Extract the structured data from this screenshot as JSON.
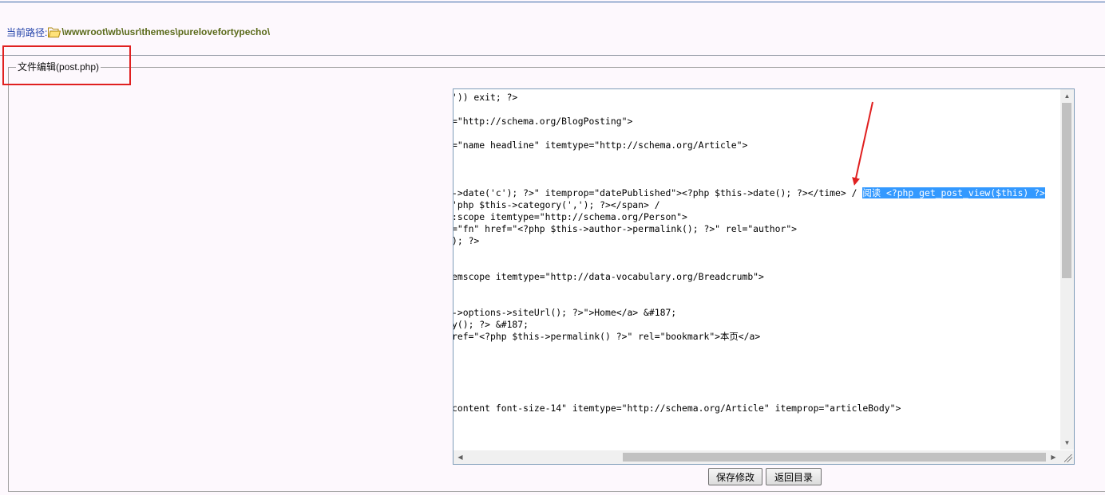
{
  "path": {
    "label": "当前路径:",
    "icon": "folder-icon",
    "value": "\\wwwroot\\wb\\usr\\themes\\purelovefortypecho\\"
  },
  "fieldset": {
    "legend": "文件编辑(post.php)"
  },
  "editor": {
    "lines": [
      "')) exit; ?>",
      "",
      "=\"http://schema.org/BlogPosting\">",
      "",
      "=\"name headline\" itemtype=\"http://schema.org/Article\">",
      "",
      "",
      "",
      "->date('c'); ?>\" itemprop=\"datePublished\"><?php $this->date(); ?></time> / ",
      "'php $this->category(','); ?></span> /",
      ":scope itemtype=\"http://schema.org/Person\">",
      "=\"fn\" href=\"<?php $this->author->permalink(); ?>\" rel=\"author\">",
      "); ?>",
      "",
      "",
      "emscope itemtype=\"http://data-vocabulary.org/Breadcrumb\">",
      "",
      "",
      "->options->siteUrl(); ?>\">Home</a> &#187;",
      "y(); ?> &#187;",
      "ref=\"<?php $this->permalink() ?>\" rel=\"bookmark\">本页</a>",
      "",
      "",
      "",
      "",
      "",
      "content font-size-14\" itemtype=\"http://schema.org/Article\" itemprop=\"articleBody\">"
    ],
    "selected_text": "阅读 <?php get_post_view($this) ?>",
    "highlight_color": "#3399ff"
  },
  "buttons": {
    "save": "保存修改",
    "back": "返回目录"
  },
  "annotation": {
    "box_color": "#e02020",
    "arrow_color": "#e02020"
  }
}
